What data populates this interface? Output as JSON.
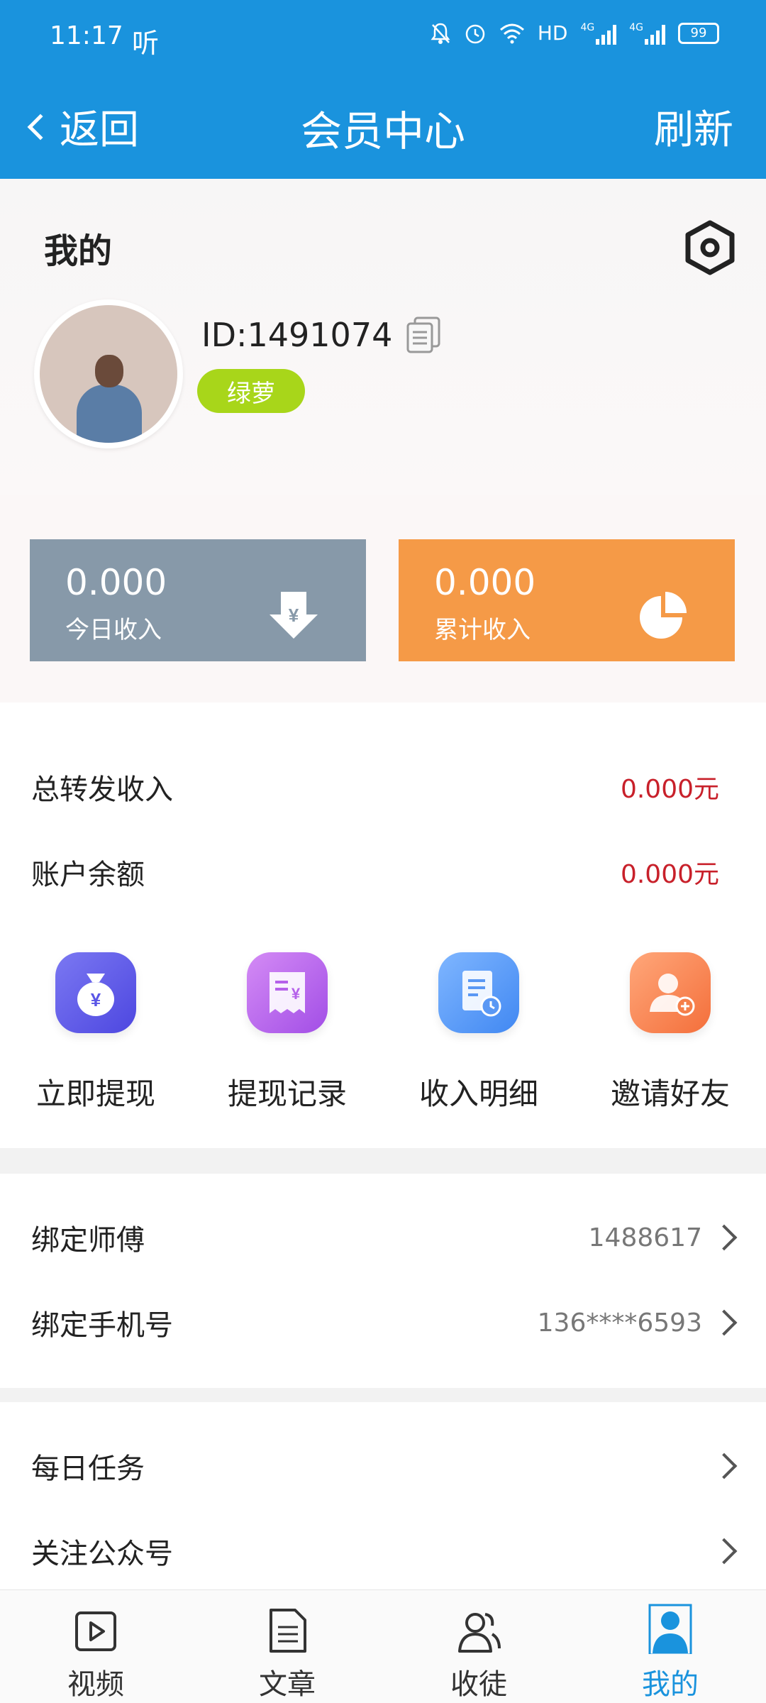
{
  "status_bar": {
    "time": "11:17",
    "audio_icon": "听",
    "network": "HD",
    "sig1_label": "4G",
    "sig2_label": "4G",
    "battery": "99"
  },
  "header": {
    "back_label": "返回",
    "title": "会员中心",
    "refresh_label": "刷新",
    "bg_color": "#1a93dd"
  },
  "profile": {
    "section_title": "我的",
    "user_id": "ID:1491074",
    "level_tag": "绿萝",
    "tag_color": "#a8d61a"
  },
  "income": {
    "today_value": "0.000",
    "today_label": "今日收入",
    "total_value": "0.000",
    "total_label": "累计收入",
    "today_color": "#8799a9",
    "total_color": "#f59a47"
  },
  "money": {
    "forward_label": "总转发收入",
    "forward_amount": "0.000元",
    "balance_label": "账户余额",
    "balance_amount": "0.000元"
  },
  "shortcuts": [
    {
      "label": "立即提现",
      "icon": "money-bag-icon"
    },
    {
      "label": "提现记录",
      "icon": "receipt-icon"
    },
    {
      "label": "收入明细",
      "icon": "document-clock-icon"
    },
    {
      "label": "邀请好友",
      "icon": "add-user-icon"
    }
  ],
  "bind": {
    "master_label": "绑定师傅",
    "master_value": "1488617",
    "phone_label": "绑定手机号",
    "phone_value": "136****6593"
  },
  "tasks": {
    "daily_label": "每日任务",
    "follow_label": "关注公众号"
  },
  "tabbar": [
    {
      "label": "视频",
      "icon": "video-icon"
    },
    {
      "label": "文章",
      "icon": "article-icon"
    },
    {
      "label": "收徒",
      "icon": "users-icon"
    },
    {
      "label": "我的",
      "icon": "me-icon",
      "active": true
    }
  ]
}
